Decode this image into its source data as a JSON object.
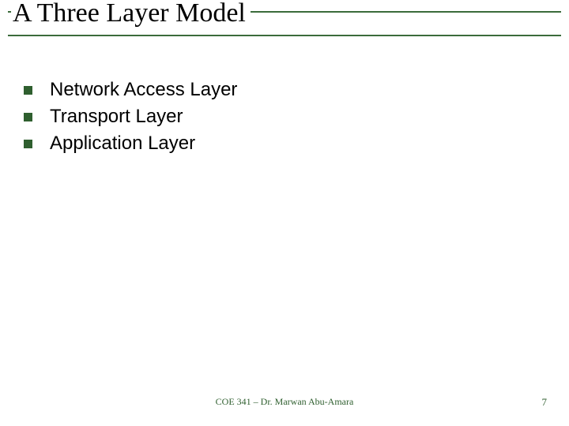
{
  "title": "A Three Layer Model",
  "bullets": [
    "Network Access Layer",
    "Transport Layer",
    "Application Layer"
  ],
  "footer": {
    "center": "COE 341 – Dr. Marwan Abu-Amara",
    "page": "7"
  }
}
